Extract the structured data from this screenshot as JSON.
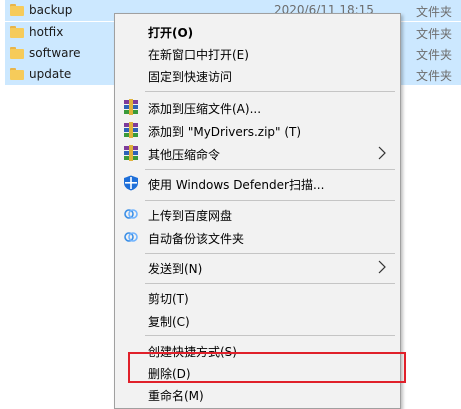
{
  "files": [
    {
      "name": "backup",
      "date": "2020/6/11 18:15",
      "type": "文件夹"
    },
    {
      "name": "hotfix",
      "date": "",
      "type": "文件夹"
    },
    {
      "name": "software",
      "date": "",
      "type": "文件夹"
    },
    {
      "name": "update",
      "date": "",
      "type": "文件夹"
    }
  ],
  "menu": {
    "open": "打开(O)",
    "open_new_window": "在新窗口中打开(E)",
    "pin_quick_access": "固定到快速访问",
    "add_to_archive": "添加到压缩文件(A)...",
    "add_to_zip": "添加到 \"MyDrivers.zip\" (T)",
    "other_compress": "其他压缩命令",
    "defender_scan": "使用 Windows Defender扫描...",
    "upload_baidu": "上传到百度网盘",
    "auto_backup": "自动备份该文件夹",
    "send_to": "发送到(N)",
    "cut": "剪切(T)",
    "copy": "复制(C)",
    "create_shortcut": "创建快捷方式(S)",
    "delete": "删除(D)",
    "rename": "重命名(M)"
  },
  "colors": {
    "highlight_box": "#e0202a",
    "selection": "#cce8ff",
    "defender": "#1e6fd9"
  }
}
